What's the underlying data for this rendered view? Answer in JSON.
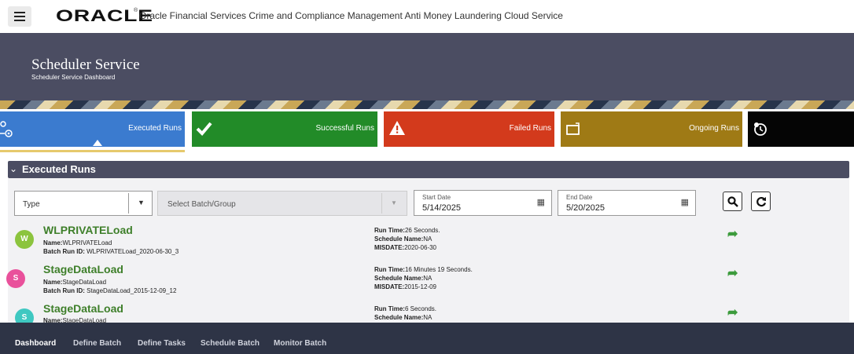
{
  "header": {
    "logo": "ORACLE",
    "registered": "®",
    "app_title": "Oracle Financial Services Crime and Compliance Management Anti Money Laundering Cloud Service"
  },
  "page": {
    "title": "Scheduler Service",
    "subtitle": "Scheduler Service Dashboard"
  },
  "tiles": [
    {
      "label": "Executed Runs",
      "color": "#3b7bcf",
      "icon": "gears-icon"
    },
    {
      "label": "Successful Runs",
      "color": "#228b28",
      "icon": "checkmark-icon"
    },
    {
      "label": "Failed Runs",
      "color": "#d33a1c",
      "icon": "warning-icon"
    },
    {
      "label": "Ongoing Runs",
      "color": "#9f7a15",
      "icon": "ongoing-icon"
    },
    {
      "label": "",
      "color": "#050505",
      "icon": "scheduled-clock-icon"
    }
  ],
  "section": {
    "title": "Executed Runs",
    "chevron": "⌄"
  },
  "filters": {
    "type_placeholder": "Type",
    "batch_placeholder": "Select Batch/Group",
    "start_label": "Start Date",
    "start_value": "5/14/2025",
    "end_label": "End Date",
    "end_value": "5/20/2025"
  },
  "runs": [
    {
      "initial": "W",
      "avatar_color": "#8cc43e",
      "name": "WLPRIVATELoad",
      "name_label": "Name:",
      "name_value": "WLPRIVATELoad",
      "batch_label": "Batch Run ID:",
      "batch_value": "WLPRIVATELoad_2020-06-30_3",
      "runtime_label": "Run Time:",
      "runtime_value": "26 Seconds.",
      "schedule_label": "Schedule Name:",
      "schedule_value": "NA",
      "misdate_label": "MISDATE:",
      "misdate_value": "2020-06-30"
    },
    {
      "initial": "S",
      "avatar_color": "#e9519b",
      "name": "StageDataLoad",
      "name_label": "Name:",
      "name_value": "StageDataLoad",
      "batch_label": "Batch Run ID:",
      "batch_value": "StageDataLoad_2015-12-09_12",
      "runtime_label": "Run Time:",
      "runtime_value": "16 Minutes 19 Seconds.",
      "schedule_label": "Schedule Name:",
      "schedule_value": "NA",
      "misdate_label": "MISDATE:",
      "misdate_value": "2015-12-09"
    },
    {
      "initial": "S",
      "avatar_color": "#3fc8c1",
      "name": "StageDataLoad",
      "name_label": "Name:",
      "name_value": "StageDataLoad",
      "runtime_label": "Run Time:",
      "runtime_value": "6 Seconds.",
      "schedule_label": "Schedule Name:",
      "schedule_value": "NA"
    }
  ],
  "tabs": [
    "Dashboard",
    "Define Batch",
    "Define Tasks",
    "Schedule Batch",
    "Monitor Batch"
  ]
}
